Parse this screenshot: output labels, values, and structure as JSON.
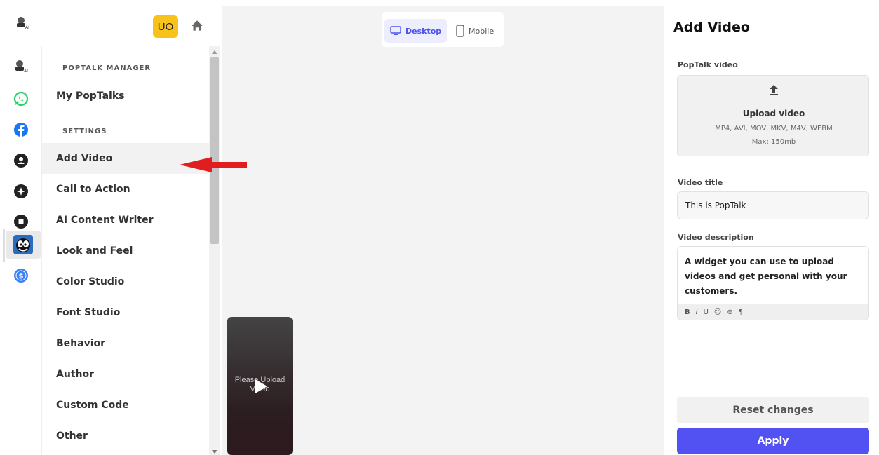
{
  "header": {
    "user_initials": "UO",
    "logo_icon": "assistant-logo-icon",
    "home_icon": "home-icon"
  },
  "rail": {
    "items": [
      {
        "icon": "assistant-logo-icon",
        "color": "#444444"
      },
      {
        "icon": "whatsapp-icon",
        "color": "#25d366"
      },
      {
        "icon": "facebook-icon",
        "color": "#1877f2"
      },
      {
        "icon": "contact-icon",
        "color": "#222222"
      },
      {
        "icon": "sparkle-icon",
        "color": "#222222"
      },
      {
        "icon": "widget-icon",
        "color": "#222222"
      },
      {
        "icon": "poptalk-felix-icon",
        "color": "#2a6cc0",
        "active": true
      },
      {
        "icon": "dollar-icon",
        "color": "#3b82f6"
      }
    ]
  },
  "menu": {
    "section_manager": "POPTALK MANAGER",
    "section_settings": "SETTINGS",
    "items": [
      {
        "label": "My PopTalks"
      },
      {
        "label": "Add Video",
        "active": true
      },
      {
        "label": "Call to Action"
      },
      {
        "label": "AI Content Writer"
      },
      {
        "label": "Look and Feel"
      },
      {
        "label": "Color Studio"
      },
      {
        "label": "Font Studio"
      },
      {
        "label": "Behavior"
      },
      {
        "label": "Author"
      },
      {
        "label": "Custom Code"
      },
      {
        "label": "Other"
      }
    ]
  },
  "preview": {
    "desktop_label": "Desktop",
    "mobile_label": "Mobile",
    "active_device": "Desktop",
    "video_placeholder": "Please Upload Video"
  },
  "panel": {
    "title": "Add Video",
    "video_label": "PopTalk video",
    "upload_title": "Upload video",
    "upload_formats": "MP4, AVI, MOV, MKV, M4V, WEBM",
    "upload_max": "Max: 150mb",
    "title_label": "Video title",
    "title_value": "This is PopTalk",
    "description_label": "Video description",
    "description_value": "A widget you can use to upload videos and get personal with your customers.",
    "toolbar": {
      "bold": "B",
      "italic": "I",
      "underline": "U",
      "emoji": "☺",
      "link": "⊖",
      "format": "¶"
    },
    "reset_label": "Reset changes",
    "apply_label": "Apply"
  },
  "colors": {
    "accent": "#5252f2",
    "avatar": "#f8c21c",
    "annotation_arrow": "#e11d1d"
  }
}
